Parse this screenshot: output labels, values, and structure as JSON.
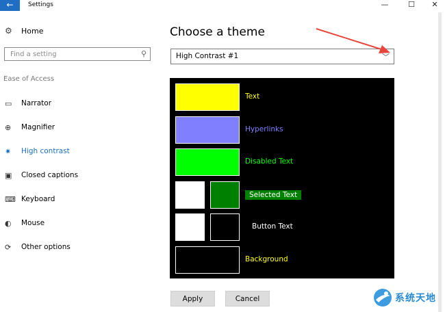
{
  "window": {
    "title": "Settings",
    "back_icon": "←",
    "controls": {
      "minimize": "—",
      "maximize": "☐",
      "close": "✕"
    }
  },
  "sidebar": {
    "home": {
      "icon": "⚙",
      "label": "Home"
    },
    "search": {
      "placeholder": "Find a setting",
      "icon": "⚲"
    },
    "section_label": "Ease of Access",
    "items": [
      {
        "icon": "▭",
        "label": "Narrator",
        "active": false
      },
      {
        "icon": "⊕",
        "label": "Magnifier",
        "active": false
      },
      {
        "icon": "✷",
        "label": "High contrast",
        "active": true
      },
      {
        "icon": "▣",
        "label": "Closed captions",
        "active": false
      },
      {
        "icon": "⌨",
        "label": "Keyboard",
        "active": false
      },
      {
        "icon": "◐",
        "label": "Mouse",
        "active": false
      },
      {
        "icon": "⟳",
        "label": "Other options",
        "active": false
      }
    ],
    "active_color": "#1b6ec2"
  },
  "main": {
    "title": "Choose a theme",
    "theme_select": {
      "value": "High Contrast #1",
      "chevron": "﹀"
    },
    "preview": {
      "background": "#000000",
      "rows": [
        {
          "label": "Text",
          "label_color": "#ffff00",
          "swatches": [
            "#ffff00"
          ]
        },
        {
          "label": "Hyperlinks",
          "label_color": "#8080ff",
          "swatches": [
            "#8080ff"
          ]
        },
        {
          "label": "Disabled Text",
          "label_color": "#00ff00",
          "swatches": [
            "#00ff00"
          ]
        },
        {
          "label": "Selected Text",
          "label_color": "#ffffff",
          "swatches": [
            "#ffffff",
            "#008000"
          ]
        },
        {
          "label": "Button Text",
          "label_color": "#ffffff",
          "swatches": [
            "#ffffff",
            "#000000"
          ]
        },
        {
          "label": "Background",
          "label_color": "#ffff00",
          "swatches": [
            "#000000"
          ]
        }
      ]
    },
    "buttons": {
      "apply": "Apply",
      "cancel": "Cancel"
    }
  },
  "annotation_arrow_color": "#e8453c",
  "watermark": {
    "text": "系统天地"
  }
}
